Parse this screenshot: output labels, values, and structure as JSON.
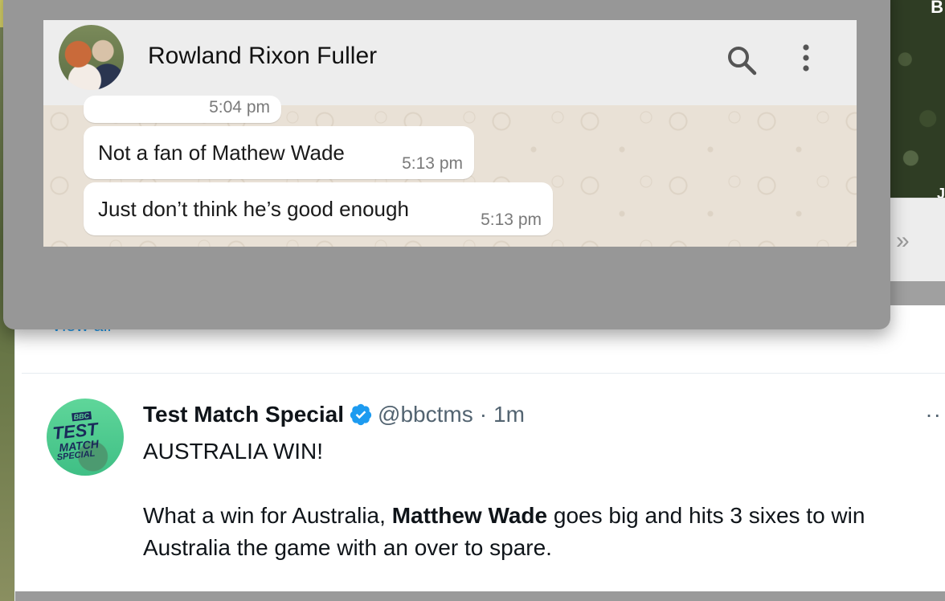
{
  "chat": {
    "contact_name": "Rowland Rixon Fuller",
    "search_icon": "search-icon",
    "menu_icon": "kebab-menu-icon",
    "messages": [
      {
        "text": "",
        "time": "5:04 pm"
      },
      {
        "text": "Not a fan of Mathew Wade",
        "time": "5:13 pm"
      },
      {
        "text": "Just don’t think he’s good enough",
        "time": "5:13 pm"
      }
    ]
  },
  "tweet": {
    "view_all": "View all",
    "author_name": "Test Match Special",
    "verified_icon": "verified-badge-icon",
    "handle": "@bbctms",
    "separator": "·",
    "time": "1m",
    "more_icon": "more-options-icon",
    "more_label": "··",
    "avatar_text": {
      "bbc": "BBC",
      "line1": "TEST",
      "line2": "MATCH",
      "line3": "SPECIAL"
    },
    "line1": "AUSTRALIA WIN!",
    "line2_prefix": "What a win for Australia, ",
    "line2_bold": "Matthew Wade",
    "line2_suffix": " goes big and hits 3 sixes to win Australia the game with an over to spare."
  },
  "background": {
    "right_chevron": "»",
    "right_letter_top": "B",
    "right_letter_bottom": "J"
  },
  "colors": {
    "accent_blue": "#1d9bf0",
    "chat_header": "#ededed",
    "chat_wallpaper": "#e9e1d6",
    "overlay": "#979797"
  }
}
